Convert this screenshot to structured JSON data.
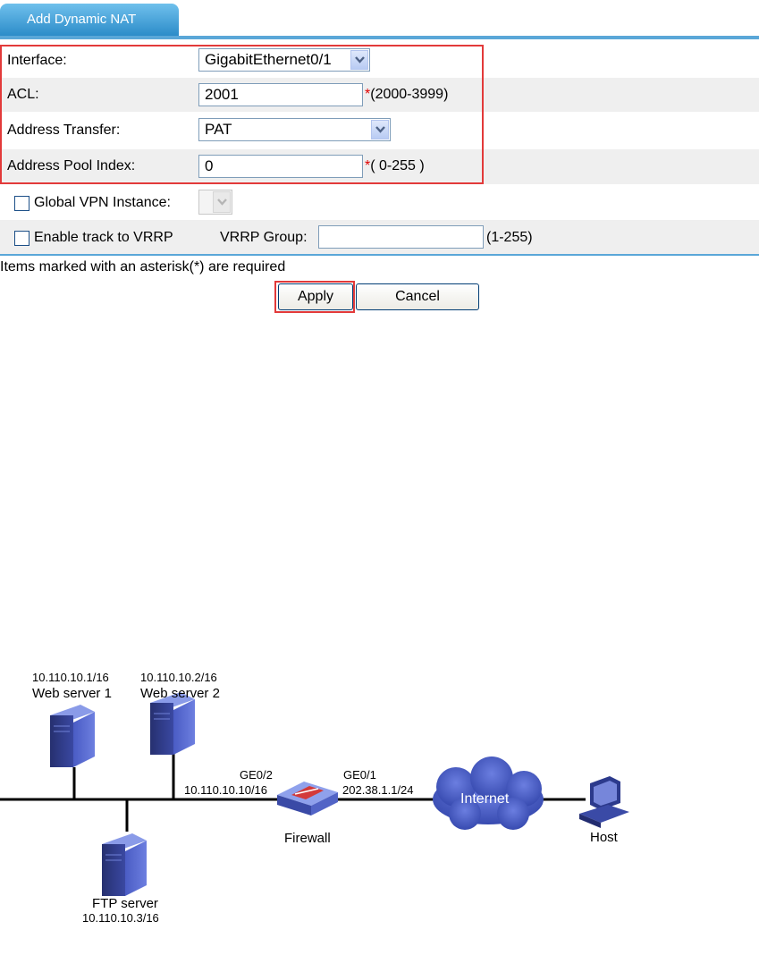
{
  "tab": {
    "title": "Add Dynamic NAT"
  },
  "form": {
    "interface": {
      "label": "Interface:",
      "value": "GigabitEthernet0/1"
    },
    "acl": {
      "label": "ACL:",
      "value": "2001",
      "asterisk": "*",
      "range": "(2000-3999)"
    },
    "address_transfer": {
      "label": "Address Transfer:",
      "value": "PAT"
    },
    "address_pool_index": {
      "label": "Address Pool Index:",
      "value": "0",
      "asterisk": "*",
      "range": "( 0-255 )"
    },
    "global_vpn_instance": {
      "label": "Global VPN Instance:",
      "value": ""
    },
    "enable_track": {
      "label": "Enable track to VRRP"
    },
    "vrrp_group": {
      "label": "VRRP Group:",
      "value": "",
      "range": "(1-255)"
    }
  },
  "footer": {
    "required_note": "Items marked with an asterisk(*) are required",
    "apply_label": "Apply",
    "cancel_label": "Cancel"
  },
  "diagram": {
    "web_server_1": {
      "ip": "10.110.10.1/16",
      "name": "Web server 1"
    },
    "web_server_2": {
      "ip": "10.110.10.2/16",
      "name": "Web server 2"
    },
    "ftp_server": {
      "name": "FTP server",
      "ip": "10.110.10.3/16"
    },
    "firewall": {
      "name": "Firewall",
      "inside_port": "GE0/2",
      "inside_ip": "10.110.10.10/16",
      "outside_port": "GE0/1",
      "outside_ip": "202.38.1.1/24"
    },
    "internet": {
      "name": "Internet"
    },
    "host": {
      "name": "Host"
    }
  },
  "colors": {
    "tab_accent": "#2c8cc9",
    "highlight": "#e23a3a",
    "device_blue": "#2c3a8c",
    "cloud": "#3e52b8"
  }
}
